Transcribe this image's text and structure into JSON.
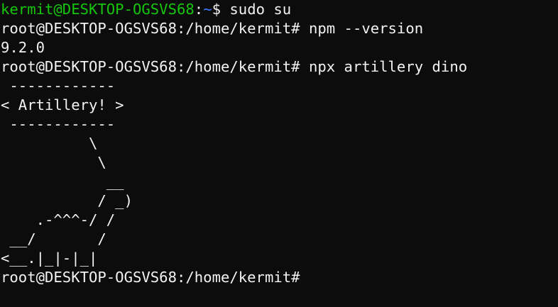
{
  "terminal": {
    "colors": {
      "background": "#0c0c0c",
      "foreground": "#f2f2f2",
      "user_host": "#16c60c",
      "path": "#3b78ff"
    },
    "first_prompt": {
      "user_host": "kermit@DESKTOP-OGSVS68",
      "colon": ":",
      "path": "~",
      "sign": "$",
      "command": " sudo su"
    },
    "lines": [
      "root@DESKTOP-OGSVS68:/home/kermit# npm --version",
      "9.2.0",
      "root@DESKTOP-OGSVS68:/home/kermit# npx artillery dino"
    ],
    "ascii_art": [
      " ------------",
      "< Artillery! >",
      " ------------",
      "          \\",
      "           \\",
      "            __",
      "           / _)",
      "    .-^^^-/ /",
      " __/       /",
      "<__.|_|-|_|"
    ],
    "final_prompt": "root@DESKTOP-OGSVS68:/home/kermit#"
  }
}
